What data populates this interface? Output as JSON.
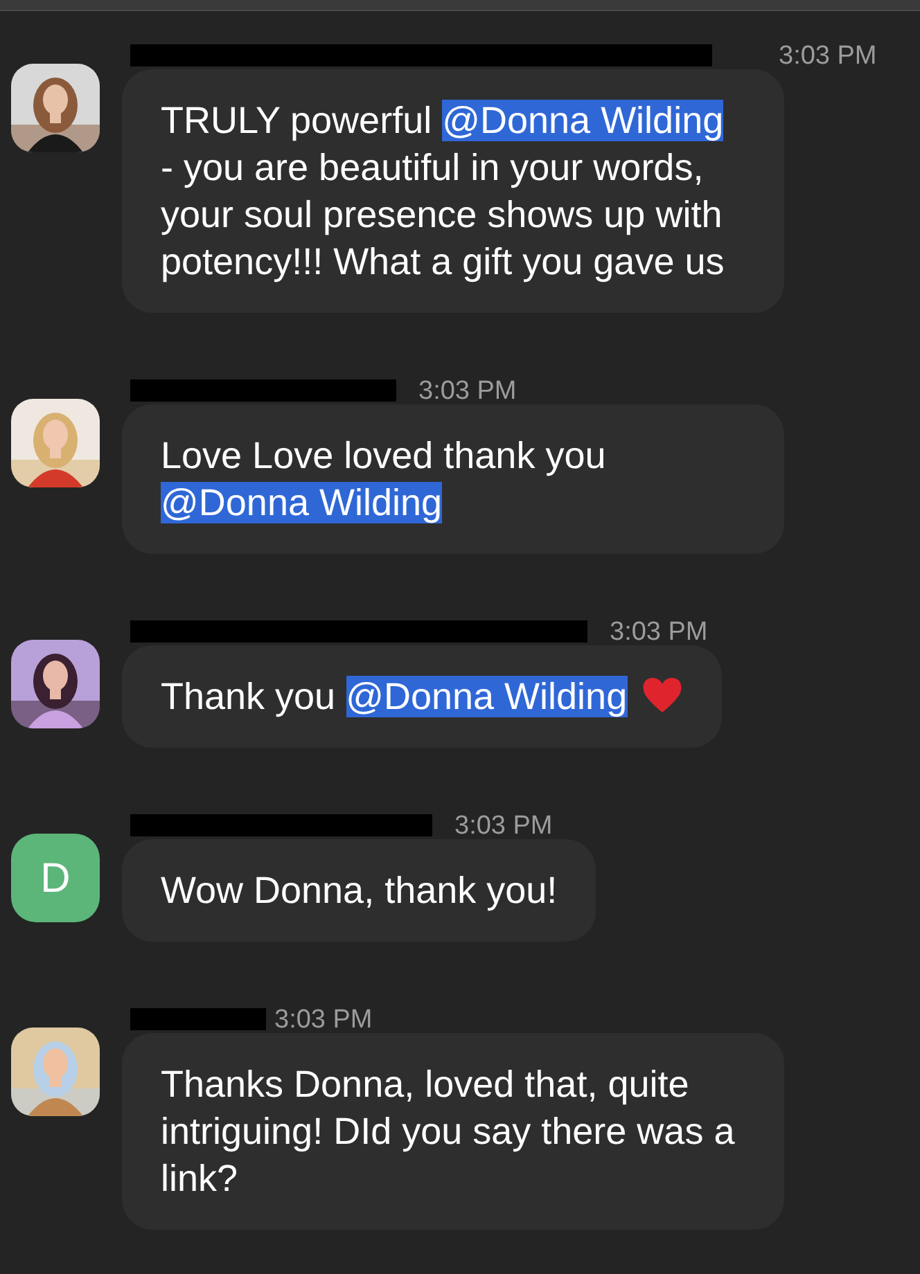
{
  "messages": [
    {
      "sender": {
        "redacted": true
      },
      "time": "3:03 PM",
      "avatar": {
        "kind": "picture"
      },
      "parts": [
        {
          "kind": "text",
          "text": "TRULY powerful "
        },
        {
          "kind": "mention",
          "text": "@Donna Wilding"
        },
        {
          "kind": "text",
          "text": " - you are beautiful in your words, your soul presence shows up with potency!!! What a gift you gave us"
        }
      ]
    },
    {
      "sender": {
        "redacted": true
      },
      "time": "3:03 PM",
      "avatar": {
        "kind": "picture"
      },
      "parts": [
        {
          "kind": "text",
          "text": "Love Love loved thank you "
        },
        {
          "kind": "mention",
          "text": "@Donna Wilding"
        }
      ]
    },
    {
      "sender": {
        "redacted": true
      },
      "time": "3:03 PM",
      "avatar": {
        "kind": "picture"
      },
      "parts": [
        {
          "kind": "text",
          "text": "Thank you "
        },
        {
          "kind": "mention",
          "text": "@Donna Wilding"
        },
        {
          "kind": "heart"
        }
      ]
    },
    {
      "sender": {
        "redacted": true
      },
      "time": "3:03 PM",
      "avatar": {
        "kind": "letter",
        "letter": "D",
        "color": "#5cb67a"
      },
      "parts": [
        {
          "kind": "text",
          "text": "Wow Donna, thank you!"
        }
      ]
    },
    {
      "sender": {
        "redacted": true
      },
      "time": "3:03 PM",
      "avatar": {
        "kind": "picture"
      },
      "parts": [
        {
          "kind": "text",
          "text": "Thanks Donna, loved that, quite intriguing! DId you say there was a link?"
        }
      ]
    }
  ]
}
